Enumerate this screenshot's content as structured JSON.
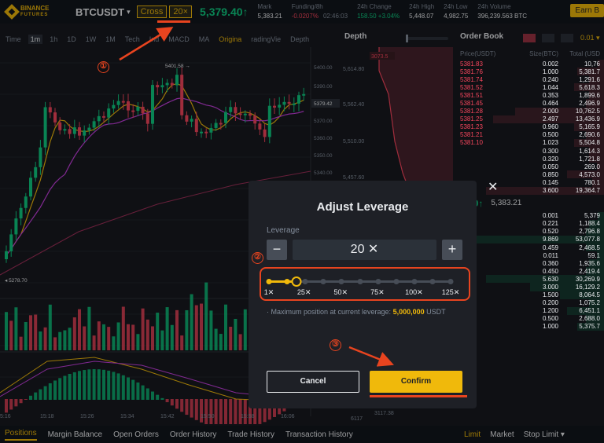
{
  "header": {
    "logo_line1": "BINANCE",
    "logo_line2": "FUTURES",
    "symbol": "BTCUSDT",
    "margin_mode": "Cross",
    "leverage": "20×",
    "last_price": "5,379.40↑",
    "stats": [
      {
        "label": "Mark",
        "value": "5,383.21",
        "value2": "",
        "tone": "white"
      },
      {
        "label": "Funding/8h",
        "value": "-0.0207%",
        "value2": "02:46:03",
        "tone": "red"
      },
      {
        "label": "24h Change",
        "value": "158.50 +3.04%",
        "value2": "",
        "tone": "green"
      },
      {
        "label": "24h High",
        "value": "5,448.07",
        "value2": "",
        "tone": "white"
      },
      {
        "label": "24h Low",
        "value": "4,982.75",
        "value2": "",
        "tone": "white"
      },
      {
        "label": "24h Volume",
        "value": "396,239.563 BTC",
        "value2": "",
        "tone": "white"
      }
    ],
    "earn_button": "Earn B"
  },
  "chart_toolbar": [
    "Time",
    "1m",
    "1h",
    "1D",
    "1W",
    "1M",
    "Tech",
    "Ind",
    "MACD",
    "MA",
    "Origina",
    "radingVie",
    "Depth"
  ],
  "chart": {
    "price_labels": [
      "5400.00",
      "5390.00",
      "5379.42",
      "5370.00",
      "5360.00",
      "5350.00",
      "5340.00"
    ],
    "high_label": "5401.58",
    "low_label": "5278.70",
    "time_labels": [
      "5:16",
      "15:18",
      "15:26",
      "15:34",
      "15:42",
      "15:50",
      "15:58",
      "16:06"
    ]
  },
  "depth": {
    "title": "Depth",
    "price_labels": [
      "5,614.80",
      "5,562.40",
      "5,510.00",
      "5,457.60"
    ],
    "top_label": "3073.5",
    "bottom_labels": [
      "6117",
      "3117.38"
    ]
  },
  "orderbook": {
    "title": "Order Book",
    "step": "0.01",
    "columns": [
      "Price(USDT)",
      "Size(BTC)",
      "Total (USD"
    ],
    "asks": [
      {
        "price": "5381.83",
        "size": "0.002",
        "total": "10,76",
        "depth": 0.04
      },
      {
        "price": "5381.76",
        "size": "1.000",
        "total": "5,381.7",
        "depth": 0.18
      },
      {
        "price": "5381.74",
        "size": "0.240",
        "total": "1,291.6",
        "depth": 0.1
      },
      {
        "price": "5381.52",
        "size": "1.044",
        "total": "5,618.3",
        "depth": 0.2
      },
      {
        "price": "5381.51",
        "size": "0.353",
        "total": "1,899.6",
        "depth": 0.1
      },
      {
        "price": "5381.45",
        "size": "0.464",
        "total": "2,496.9",
        "depth": 0.12
      },
      {
        "price": "5381.28",
        "size": "2.000",
        "total": "10,762.5",
        "depth": 0.6
      },
      {
        "price": "5381.25",
        "size": "2.497",
        "total": "13,436.9",
        "depth": 0.75
      },
      {
        "price": "5381.23",
        "size": "0.960",
        "total": "5,165.9",
        "depth": 0.2
      },
      {
        "price": "5381.21",
        "size": "0.500",
        "total": "2,690.6",
        "depth": 0.12
      },
      {
        "price": "5381.10",
        "size": "1.023",
        "total": "5,504.8",
        "depth": 0.2
      },
      {
        "price": "",
        "size": "0.300",
        "total": "1,614.3",
        "depth": 0.1
      },
      {
        "price": "",
        "size": "0.320",
        "total": "1,721.8",
        "depth": 0.1
      },
      {
        "price": "",
        "size": "0.050",
        "total": "269.0",
        "depth": 0.05
      },
      {
        "price": "",
        "size": "0.850",
        "total": "4,573.0",
        "depth": 0.25
      },
      {
        "price": "",
        "size": "0.145",
        "total": "780.1",
        "depth": 0.08
      },
      {
        "price": "",
        "size": "3.600",
        "total": "19,364.7",
        "depth": 0.8
      }
    ],
    "mid_price": "9.40↑",
    "mid_index": "5,383.21",
    "bids": [
      {
        "price": "",
        "size": "0.001",
        "total": "5,379",
        "depth": 0.04
      },
      {
        "price": "",
        "size": "0.221",
        "total": "1,188.4",
        "depth": 0.1
      },
      {
        "price": "",
        "size": "0.520",
        "total": "2,796.8",
        "depth": 0.12
      },
      {
        "price": "",
        "size": "9.869",
        "total": "53,077.8",
        "depth": 0.95
      },
      {
        "price": "",
        "size": "0.459",
        "total": "2,468.5",
        "depth": 0.12
      },
      {
        "price": "",
        "size": "0.011",
        "size2": "",
        "total": "59.1",
        "depth": 0.05
      },
      {
        "price": "",
        "size": "0.360",
        "total": "1,935.6",
        "depth": 0.1
      },
      {
        "price": "",
        "size": "0.450",
        "total": "2,419.4",
        "depth": 0.12
      },
      {
        "price": "",
        "size": "5.630",
        "total": "30,269.9",
        "depth": 0.8
      },
      {
        "price": "",
        "size": "3.000",
        "total": "16,129.2",
        "depth": 0.5
      },
      {
        "price": "",
        "size": "1.500",
        "total": "8,064.5",
        "depth": 0.3
      },
      {
        "price": "",
        "size": "0.200",
        "total": "1,075.2",
        "depth": 0.1
      },
      {
        "price": "",
        "size": "1.200",
        "total": "6,451.1",
        "depth": 0.25
      },
      {
        "price": "",
        "size": "0.500",
        "total": "2,688.0",
        "depth": 0.12
      },
      {
        "price": "",
        "size": "1.000",
        "total": "5,375.7",
        "depth": 0.18
      }
    ]
  },
  "bottom_tabs": [
    "Positions",
    "Margin Balance",
    "Open Orders",
    "Order History",
    "Trade History",
    "Transaction History"
  ],
  "order_tabs": [
    "Limit",
    "Market",
    "Stop Limit ▾"
  ],
  "modal": {
    "title": "Adjust Leverage",
    "close": "✕",
    "leverage_label": "Leverage",
    "minus": "−",
    "plus": "+",
    "leverage_value": "20 ✕",
    "slider": {
      "min": 1,
      "max": 125,
      "value": 20,
      "ticks": [
        "1✕",
        "25✕",
        "50✕",
        "75✕",
        "100✕",
        "125✕"
      ]
    },
    "max_position_prefix": "· Maximum position at current leverage: ",
    "max_position_value": "5,000,000",
    "max_position_unit": " USDT",
    "cancel": "Cancel",
    "confirm": "Confirm"
  },
  "annotations": {
    "step1": "①",
    "step2": "②",
    "step3": "③",
    "color": "#e8441f"
  },
  "colors": {
    "accent": "#f0b90b",
    "up": "#0ecb81",
    "down": "#f6465d",
    "bg": "#181a20"
  }
}
